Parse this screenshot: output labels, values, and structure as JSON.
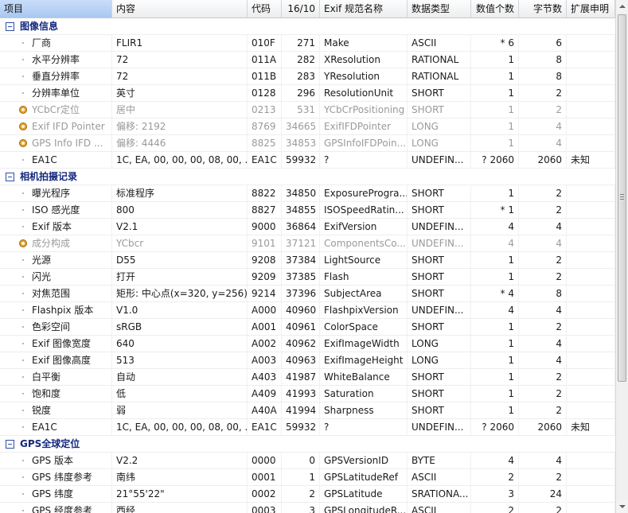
{
  "columns": [
    "项目",
    "内容",
    "代码",
    "16/10",
    "Exif 规范名称",
    "数据类型",
    "数值个数",
    "字节数",
    "扩展申明"
  ],
  "rows": [
    {
      "kind": "section",
      "label": "图像信息"
    },
    {
      "kind": "item",
      "name": "厂商",
      "content": "FLIR1",
      "code": "010F",
      "dec": "271",
      "exif": "Make",
      "type": "ASCII",
      "count": "* 6",
      "bytes": "6",
      "ext": ""
    },
    {
      "kind": "item",
      "name": "水平分辨率",
      "content": "72",
      "code": "011A",
      "dec": "282",
      "exif": "XResolution",
      "type": "RATIONAL",
      "count": "1",
      "bytes": "8",
      "ext": ""
    },
    {
      "kind": "item",
      "name": "垂直分辨率",
      "content": "72",
      "code": "011B",
      "dec": "283",
      "exif": "YResolution",
      "type": "RATIONAL",
      "count": "1",
      "bytes": "8",
      "ext": ""
    },
    {
      "kind": "item",
      "name": "分辨率单位",
      "content": "英寸",
      "code": "0128",
      "dec": "296",
      "exif": "ResolutionUnit",
      "type": "SHORT",
      "count": "1",
      "bytes": "2",
      "ext": ""
    },
    {
      "kind": "item",
      "icon": "gear",
      "dim": true,
      "name": "YCbCr定位",
      "content": "居中",
      "code": "0213",
      "dec": "531",
      "exif": "YCbCrPositioning",
      "type": "SHORT",
      "count": "1",
      "bytes": "2",
      "ext": ""
    },
    {
      "kind": "item",
      "icon": "gear",
      "dim": true,
      "name": "Exif IFD Pointer",
      "content": "偏移: 2192",
      "code": "8769",
      "dec": "34665",
      "exif": "ExifIFDPointer",
      "type": "LONG",
      "count": "1",
      "bytes": "4",
      "ext": ""
    },
    {
      "kind": "item",
      "icon": "gear",
      "dim": true,
      "name": "GPS Info IFD ...",
      "content": "偏移: 4446",
      "code": "8825",
      "dec": "34853",
      "exif": "GPSInfoIFDPoin...",
      "type": "LONG",
      "count": "1",
      "bytes": "4",
      "ext": ""
    },
    {
      "kind": "item",
      "name": "EA1C",
      "content": "1C, EA, 00, 00, 00, 08, 00, ...",
      "code": "EA1C",
      "dec": "59932",
      "exif": "?",
      "type": "UNDEFIN...",
      "count": "? 2060",
      "bytes": "2060",
      "ext": "未知"
    },
    {
      "kind": "section",
      "label": "相机拍摄记录"
    },
    {
      "kind": "item",
      "name": "曝光程序",
      "content": "标准程序",
      "code": "8822",
      "dec": "34850",
      "exif": "ExposureProgra...",
      "type": "SHORT",
      "count": "1",
      "bytes": "2",
      "ext": ""
    },
    {
      "kind": "item",
      "name": "ISO 感光度",
      "content": "800",
      "code": "8827",
      "dec": "34855",
      "exif": "ISOSpeedRatin...",
      "type": "SHORT",
      "count": "* 1",
      "bytes": "2",
      "ext": ""
    },
    {
      "kind": "item",
      "name": "Exif 版本",
      "content": "V2.1",
      "code": "9000",
      "dec": "36864",
      "exif": "ExifVersion",
      "type": "UNDEFIN...",
      "count": "4",
      "bytes": "4",
      "ext": ""
    },
    {
      "kind": "item",
      "icon": "gear",
      "dim": true,
      "name": "成分构成",
      "content": "YCbcr",
      "code": "9101",
      "dec": "37121",
      "exif": "ComponentsCo...",
      "type": "UNDEFIN...",
      "count": "4",
      "bytes": "4",
      "ext": ""
    },
    {
      "kind": "item",
      "name": "光源",
      "content": "D55",
      "code": "9208",
      "dec": "37384",
      "exif": "LightSource",
      "type": "SHORT",
      "count": "1",
      "bytes": "2",
      "ext": ""
    },
    {
      "kind": "item",
      "name": "闪光",
      "content": "打开",
      "code": "9209",
      "dec": "37385",
      "exif": "Flash",
      "type": "SHORT",
      "count": "1",
      "bytes": "2",
      "ext": ""
    },
    {
      "kind": "item",
      "name": "对焦范围",
      "content": "矩形: 中心点(x=320, y=256),...",
      "code": "9214",
      "dec": "37396",
      "exif": "SubjectArea",
      "type": "SHORT",
      "count": "* 4",
      "bytes": "8",
      "ext": ""
    },
    {
      "kind": "item",
      "name": "Flashpix 版本",
      "content": "V1.0",
      "code": "A000",
      "dec": "40960",
      "exif": "FlashpixVersion",
      "type": "UNDEFIN...",
      "count": "4",
      "bytes": "4",
      "ext": ""
    },
    {
      "kind": "item",
      "name": "色彩空间",
      "content": "sRGB",
      "code": "A001",
      "dec": "40961",
      "exif": "ColorSpace",
      "type": "SHORT",
      "count": "1",
      "bytes": "2",
      "ext": ""
    },
    {
      "kind": "item",
      "name": "Exif 图像宽度",
      "content": "640",
      "code": "A002",
      "dec": "40962",
      "exif": "ExifImageWidth",
      "type": "LONG",
      "count": "1",
      "bytes": "4",
      "ext": ""
    },
    {
      "kind": "item",
      "name": "Exif 图像高度",
      "content": "513",
      "code": "A003",
      "dec": "40963",
      "exif": "ExifImageHeight",
      "type": "LONG",
      "count": "1",
      "bytes": "4",
      "ext": ""
    },
    {
      "kind": "item",
      "name": "白平衡",
      "content": "自动",
      "code": "A403",
      "dec": "41987",
      "exif": "WhiteBalance",
      "type": "SHORT",
      "count": "1",
      "bytes": "2",
      "ext": ""
    },
    {
      "kind": "item",
      "name": "饱和度",
      "content": "低",
      "code": "A409",
      "dec": "41993",
      "exif": "Saturation",
      "type": "SHORT",
      "count": "1",
      "bytes": "2",
      "ext": ""
    },
    {
      "kind": "item",
      "name": "锐度",
      "content": "弱",
      "code": "A40A",
      "dec": "41994",
      "exif": "Sharpness",
      "type": "SHORT",
      "count": "1",
      "bytes": "2",
      "ext": ""
    },
    {
      "kind": "item",
      "name": "EA1C",
      "content": "1C, EA, 00, 00, 00, 08, 00, ...",
      "code": "EA1C",
      "dec": "59932",
      "exif": "?",
      "type": "UNDEFIN...",
      "count": "? 2060",
      "bytes": "2060",
      "ext": "未知"
    },
    {
      "kind": "section",
      "label": "GPS全球定位"
    },
    {
      "kind": "item",
      "name": "GPS 版本",
      "content": "V2.2",
      "code": "0000",
      "dec": "0",
      "exif": "GPSVersionID",
      "type": "BYTE",
      "count": "4",
      "bytes": "4",
      "ext": ""
    },
    {
      "kind": "item",
      "name": "GPS 纬度参考",
      "content": "南纬",
      "code": "0001",
      "dec": "1",
      "exif": "GPSLatitudeRef",
      "type": "ASCII",
      "count": "2",
      "bytes": "2",
      "ext": ""
    },
    {
      "kind": "item",
      "name": "GPS 纬度",
      "content": "21°55'22\"",
      "code": "0002",
      "dec": "2",
      "exif": "GPSLatitude",
      "type": "SRATIONA...",
      "count": "3",
      "bytes": "24",
      "ext": ""
    },
    {
      "kind": "item",
      "name": "GPS 经度参考",
      "content": "西经",
      "code": "0003",
      "dec": "3",
      "exif": "GPSLongitudeR...",
      "type": "ASCII",
      "count": "2",
      "bytes": "2",
      "ext": ""
    }
  ]
}
